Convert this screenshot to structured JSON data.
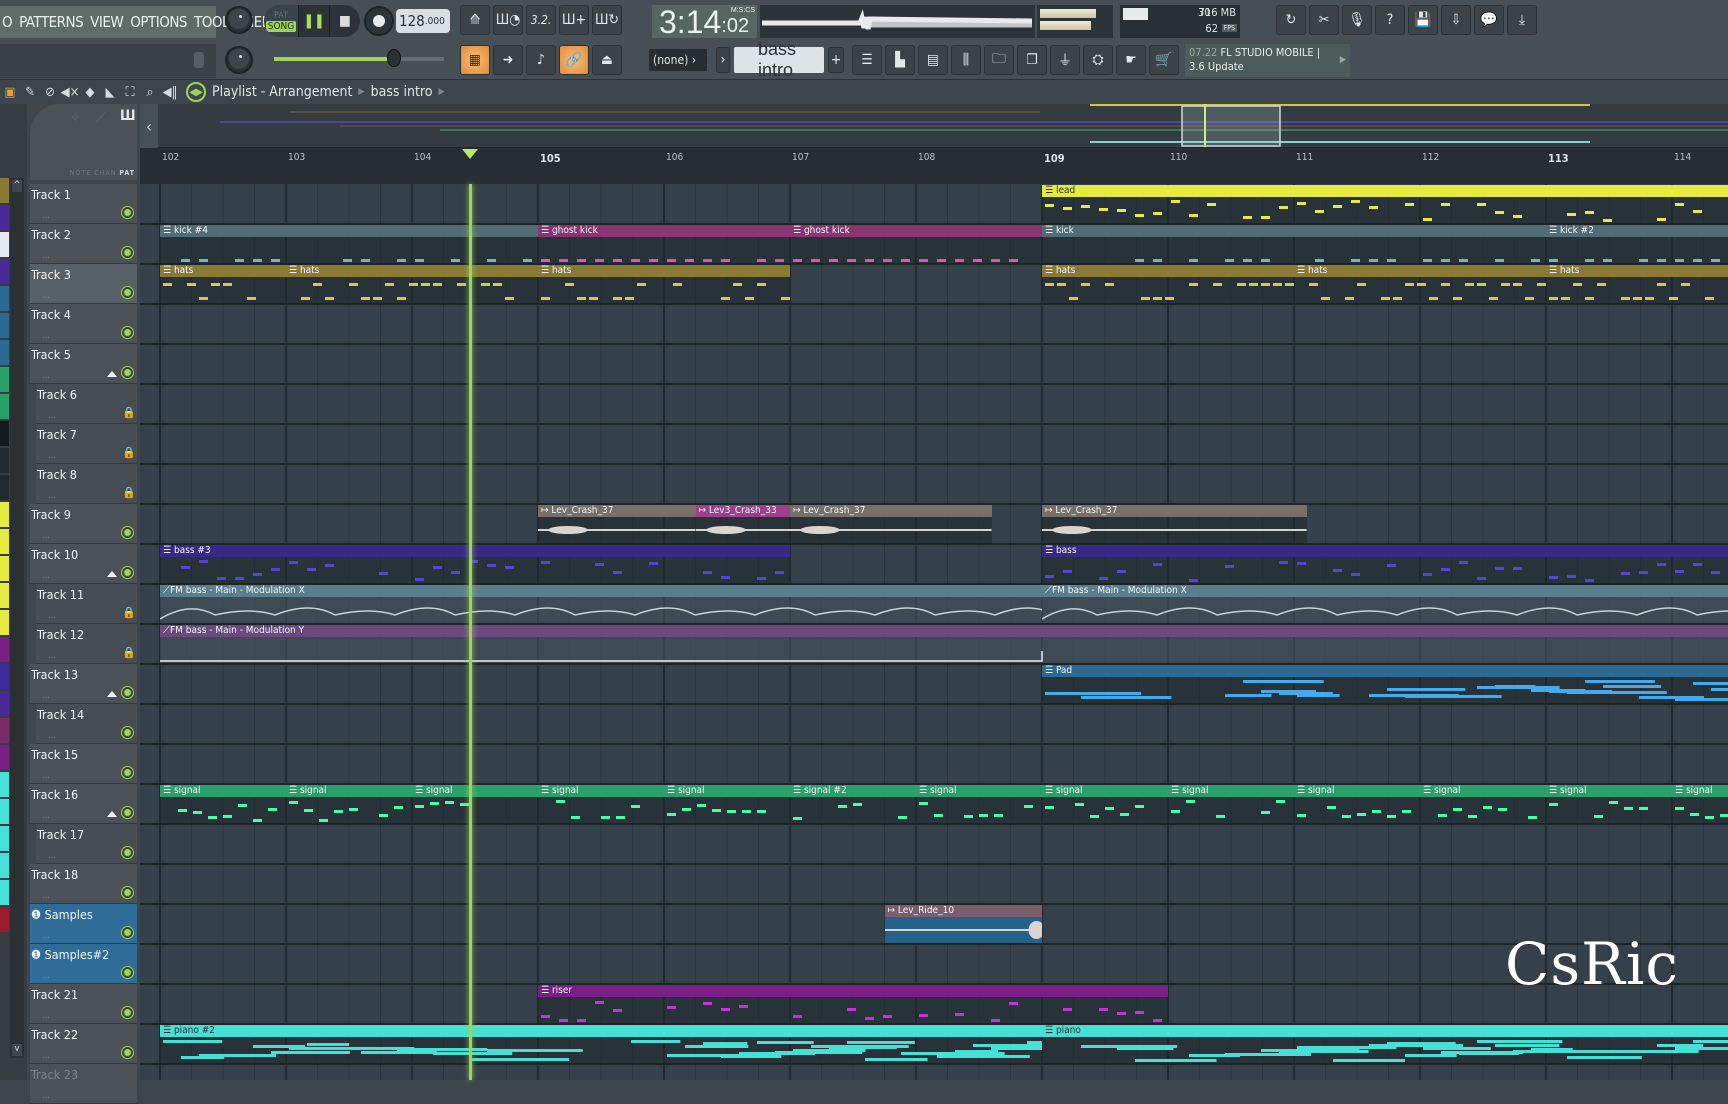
{
  "menu": {
    "items": [
      "O",
      "PATTERNS",
      "VIEW",
      "OPTIONS",
      "TOOLS",
      "HELP"
    ]
  },
  "transport": {
    "pat_label": "PAT",
    "song_label": "SONG",
    "mode": "SONG",
    "play_icon": "pause-icon",
    "stop_icon": "stop-icon",
    "record_icon": "record-icon",
    "tempo_main": "128",
    "tempo_frac": ".000"
  },
  "clock": {
    "main": "3:14",
    "small": ":02",
    "format": "M:S:CS"
  },
  "cpu": {
    "value": "30",
    "memory": "716 MB",
    "fps": "62",
    "fps_label": "FPS"
  },
  "pattern": {
    "channel_select": "(none)",
    "name": "bass intro",
    "add_label": "+"
  },
  "news": {
    "date": "07.22",
    "title": "FL STUDIO MOBILE |",
    "subtitle": "3.6 Update"
  },
  "breadcrumb": {
    "title": "Playlist - Arrangement",
    "pattern": "bass intro"
  },
  "header_modes": {
    "note": "NOTE",
    "chan": "CHAN",
    "pat": "PAT"
  },
  "ruler": {
    "bars": [
      "102",
      "103",
      "104",
      "105",
      "106",
      "107",
      "108",
      "109",
      "110",
      "111",
      "112",
      "113",
      "114"
    ]
  },
  "tracks": [
    {
      "name": "Track 1"
    },
    {
      "name": "Track 2"
    },
    {
      "name": "Track 3"
    },
    {
      "name": "Track 4"
    },
    {
      "name": "Track 5"
    },
    {
      "name": "Track 6"
    },
    {
      "name": "Track 7"
    },
    {
      "name": "Track 8"
    },
    {
      "name": "Track 9"
    },
    {
      "name": "Track 10"
    },
    {
      "name": "Track 11"
    },
    {
      "name": "Track 12"
    },
    {
      "name": "Track 13"
    },
    {
      "name": "Track 14"
    },
    {
      "name": "Track 15"
    },
    {
      "name": "Track 16"
    },
    {
      "name": "Track 17"
    },
    {
      "name": "Track 18"
    },
    {
      "name": "Samples"
    },
    {
      "name": "Samples#2"
    },
    {
      "name": "Track 21"
    },
    {
      "name": "Track 22"
    },
    {
      "name": "Track 23"
    }
  ],
  "clips": [
    {
      "track": 1,
      "label": "lead",
      "start": 109,
      "end": 114.5,
      "color": "#e6ea3f",
      "type": "pattern"
    },
    {
      "track": 2,
      "label": "kick #4",
      "start": 102,
      "end": 105,
      "color": "#4f6d73",
      "type": "pattern"
    },
    {
      "track": 2,
      "label": "ghost kick",
      "start": 105,
      "end": 107,
      "color": "#8a3472",
      "type": "pattern"
    },
    {
      "track": 2,
      "label": "ghost kick",
      "start": 107,
      "end": 109,
      "color": "#8a3472",
      "type": "pattern"
    },
    {
      "track": 2,
      "label": "kick",
      "start": 109,
      "end": 113,
      "color": "#4f6d73",
      "type": "pattern"
    },
    {
      "track": 2,
      "label": "kick #2",
      "start": 113,
      "end": 114.5,
      "color": "#4f6d73",
      "type": "pattern"
    },
    {
      "track": 3,
      "label": "hats",
      "start": 102,
      "end": 103,
      "color": "#8a7a35",
      "type": "pattern"
    },
    {
      "track": 3,
      "label": "hats",
      "start": 103,
      "end": 105,
      "color": "#8a7a35",
      "type": "pattern"
    },
    {
      "track": 3,
      "label": "hats",
      "start": 105,
      "end": 107,
      "color": "#8a7a35",
      "type": "pattern"
    },
    {
      "track": 3,
      "label": "hats",
      "start": 109,
      "end": 111,
      "color": "#8a7a35",
      "type": "pattern"
    },
    {
      "track": 3,
      "label": "hats",
      "start": 111,
      "end": 113,
      "color": "#8a7a35",
      "type": "pattern"
    },
    {
      "track": 3,
      "label": "hats",
      "start": 113,
      "end": 114.5,
      "color": "#8a7a35",
      "type": "pattern"
    },
    {
      "track": 9,
      "label": "Lev_Crash_37",
      "start": 105,
      "end": 106.25,
      "color": "#7a6e68",
      "type": "audio"
    },
    {
      "track": 9,
      "label": "Lev3_Crash_33",
      "start": 106.25,
      "end": 107,
      "color": "#9c3f8c",
      "type": "audio"
    },
    {
      "track": 9,
      "label": "Lev_Crash_37",
      "start": 107,
      "end": 108.6,
      "color": "#7a6e68",
      "type": "audio"
    },
    {
      "track": 9,
      "label": "Lev_Crash_37",
      "start": 109,
      "end": 111.1,
      "color": "#7a6e68",
      "type": "audio"
    },
    {
      "track": 10,
      "label": "bass #3",
      "start": 102,
      "end": 107,
      "color": "#352a88",
      "type": "pattern"
    },
    {
      "track": 10,
      "label": "bass",
      "start": 109,
      "end": 114.5,
      "color": "#352a88",
      "type": "pattern"
    },
    {
      "track": 11,
      "label": "FM  bass - Main - Modulation X",
      "start": 102,
      "end": 109,
      "color": "#5a7e8e",
      "type": "automation"
    },
    {
      "track": 11,
      "label": "FM  bass - Main - Modulation X",
      "start": 109,
      "end": 114.5,
      "color": "#5a7e8e",
      "type": "automation"
    },
    {
      "track": 12,
      "label": "FM  bass - Main - Modulation Y",
      "start": 102,
      "end": 114.5,
      "color": "#6b4a80",
      "type": "automation"
    },
    {
      "track": 13,
      "label": "Pad",
      "start": 109,
      "end": 114.5,
      "color": "#2a6a93",
      "type": "pattern"
    },
    {
      "track": 16,
      "label": "signal",
      "start": 102,
      "end": 103,
      "color": "#2aa06a",
      "type": "pattern"
    },
    {
      "track": 16,
      "label": "signal",
      "start": 103,
      "end": 104,
      "color": "#2aa06a",
      "type": "pattern"
    },
    {
      "track": 16,
      "label": "signal",
      "start": 104,
      "end": 105,
      "color": "#2aa06a",
      "type": "pattern"
    },
    {
      "track": 16,
      "label": "signal",
      "start": 105,
      "end": 106,
      "color": "#2aa06a",
      "type": "pattern"
    },
    {
      "track": 16,
      "label": "signal",
      "start": 106,
      "end": 107,
      "color": "#2aa06a",
      "type": "pattern"
    },
    {
      "track": 16,
      "label": "signal #2",
      "start": 107,
      "end": 108,
      "color": "#2aa06a",
      "type": "pattern"
    },
    {
      "track": 16,
      "label": "signal",
      "start": 108,
      "end": 109,
      "color": "#2aa06a",
      "type": "pattern"
    },
    {
      "track": 16,
      "label": "signal",
      "start": 109,
      "end": 110,
      "color": "#2aa06a",
      "type": "pattern"
    },
    {
      "track": 16,
      "label": "signal",
      "start": 110,
      "end": 111,
      "color": "#2aa06a",
      "type": "pattern"
    },
    {
      "track": 16,
      "label": "signal",
      "start": 111,
      "end": 112,
      "color": "#2aa06a",
      "type": "pattern"
    },
    {
      "track": 16,
      "label": "signal",
      "start": 112,
      "end": 113,
      "color": "#2aa06a",
      "type": "pattern"
    },
    {
      "track": 16,
      "label": "signal",
      "start": 113,
      "end": 114,
      "color": "#2aa06a",
      "type": "pattern"
    },
    {
      "track": 16,
      "label": "signal",
      "start": 114,
      "end": 114.5,
      "color": "#2aa06a",
      "type": "pattern"
    },
    {
      "track": 19,
      "label": "Lev_Ride_10",
      "start": 107.75,
      "end": 109,
      "color": "#7a5e6c",
      "type": "audio"
    },
    {
      "track": 21,
      "label": "riser",
      "start": 105,
      "end": 110,
      "color": "#7a1f88",
      "type": "pattern"
    },
    {
      "track": 22,
      "label": "piano #2",
      "start": 102,
      "end": 109,
      "color": "#46e0d6",
      "type": "pattern"
    },
    {
      "track": 22,
      "label": "piano",
      "start": 109,
      "end": 114.5,
      "color": "#46e0d6",
      "type": "pattern"
    }
  ],
  "playhead_bar": 104.45,
  "watermark": "CsRic",
  "accent_color": "#9fd45a"
}
